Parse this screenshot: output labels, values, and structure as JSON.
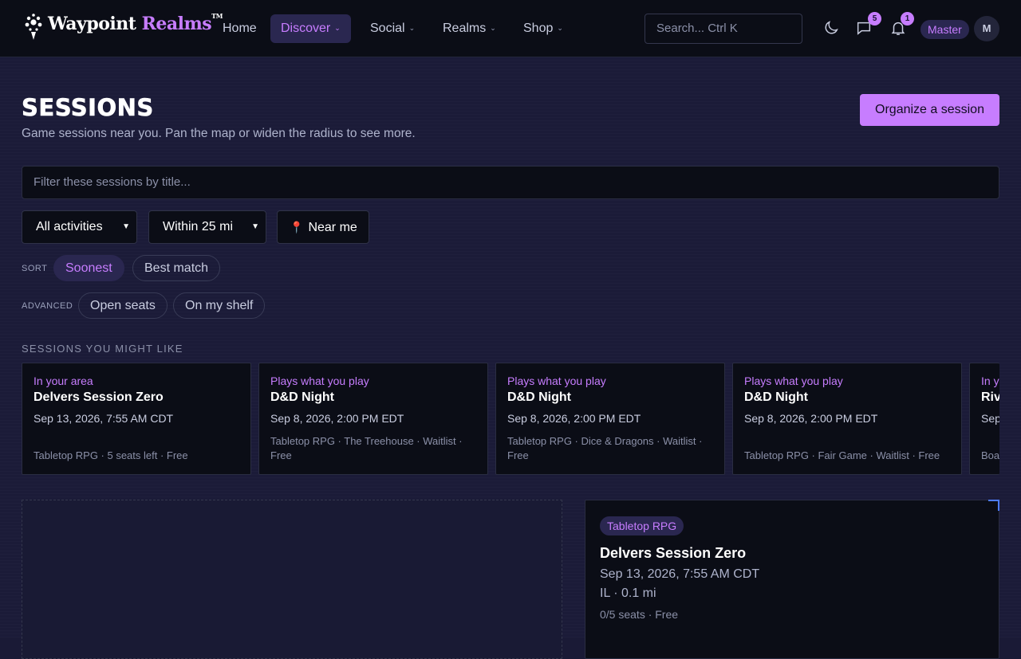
{
  "nav": {
    "logo": {
      "part1": "Waypoint",
      "part2": "Realms",
      "tm": "TM"
    },
    "items": [
      {
        "label": "Home",
        "has_menu": false
      },
      {
        "label": "Discover",
        "has_menu": true
      },
      {
        "label": "Social",
        "has_menu": true
      },
      {
        "label": "Realms",
        "has_menu": true
      },
      {
        "label": "Shop",
        "has_menu": true
      }
    ],
    "search_placeholder": "Search...  Ctrl K",
    "messages_count": "5",
    "notifications_count": "1",
    "role": "Master",
    "avatar_initial": "M",
    "icons": [
      "moon-icon",
      "chat-icon",
      "bell-icon"
    ]
  },
  "header": {
    "title": "SESSIONS",
    "subtitle": "Game sessions near you. Pan the map or widen the radius to see more.",
    "organize_label": "Organize a session"
  },
  "filters": {
    "title_placeholder": "Filter these sessions by title...",
    "activity_select": "All activities",
    "radius_select": "Within 25 mi",
    "near_me_label": "Near me"
  },
  "sort": {
    "label": "SORT",
    "options": [
      "Soonest",
      "Best match"
    ],
    "selected": "Soonest"
  },
  "advanced": {
    "label": "ADVANCED",
    "options": [
      "Open seats",
      "On my shelf"
    ]
  },
  "recommended": {
    "label": "SESSIONS YOU MIGHT LIKE",
    "cards": [
      {
        "reason": "In your area",
        "title": "Delvers Session Zero",
        "date": "Sep 13, 2026, 7:55 AM CDT",
        "meta": "Tabletop RPG · 5 seats left · Free"
      },
      {
        "reason": "Plays what you play",
        "title": "D&D Night",
        "date": "Sep 8, 2026, 2:00 PM EDT",
        "meta": "Tabletop RPG · The Treehouse · Waitlist · Free"
      },
      {
        "reason": "Plays what you play",
        "title": "D&D Night",
        "date": "Sep 8, 2026, 2:00 PM EDT",
        "meta": "Tabletop RPG · Dice & Dragons · Waitlist · Free"
      },
      {
        "reason": "Plays what you play",
        "title": "D&D Night",
        "date": "Sep 8, 2026, 2:00 PM EDT",
        "meta": "Tabletop RPG · Fair Game · Waitlist · Free"
      },
      {
        "reason": "In your area",
        "title": "Riv",
        "date": "Sep",
        "meta": "Boa"
      }
    ]
  },
  "detail": {
    "tag": "Tabletop RPG",
    "title": "Delvers Session Zero",
    "date": "Sep 13, 2026, 7:55 AM CDT",
    "location": "IL · 0.1 mi",
    "seats": "0/5 seats · Free"
  },
  "colors": {
    "accent": "#c77dff",
    "nav_bg": "#0b0d16",
    "page_bg": "#1b1b38"
  }
}
